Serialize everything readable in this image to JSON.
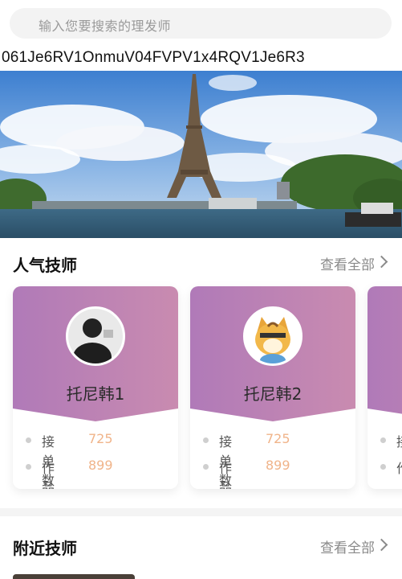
{
  "search": {
    "placeholder": "输入您要搜索的理发师"
  },
  "code_text": "061Je6RV1OnmuV04FVPV1x4RQV1Je6R3",
  "popular": {
    "title": "人气技师",
    "view_all": "查看全部",
    "cards": [
      {
        "name": "托尼韩1",
        "stats": [
          {
            "label": "接单数",
            "value": "725"
          },
          {
            "label": "作品数",
            "value": "899"
          }
        ]
      },
      {
        "name": "托尼韩2",
        "stats": [
          {
            "label": "接单数",
            "value": "725"
          },
          {
            "label": "作品数",
            "value": "899"
          }
        ]
      }
    ],
    "partial_card": {
      "stat_labels": [
        "接",
        "作"
      ]
    }
  },
  "nearby": {
    "title": "附近技师",
    "view_all": "查看全部"
  },
  "colors": {
    "card_gradient_start": "#b07ab8",
    "card_gradient_end": "#c98bb0",
    "stat_value": "#f0b48a"
  }
}
